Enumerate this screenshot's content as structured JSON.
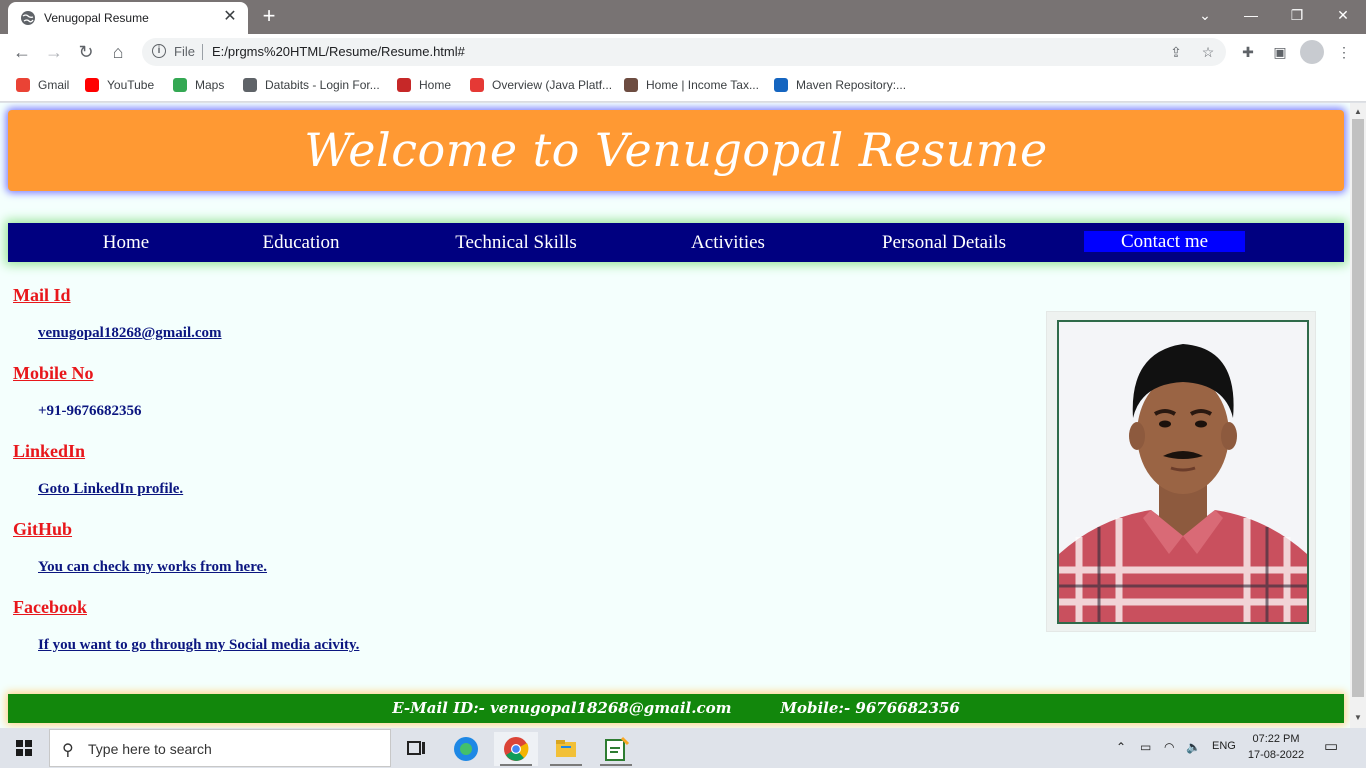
{
  "browser": {
    "tab_title": "Venugopal Resume",
    "tab_close": "✕",
    "new_tab": "+",
    "scheme_label": "File",
    "url": "E:/prgms%20HTML/Resume/Resume.html#",
    "bookmarks": [
      {
        "label": "Gmail",
        "color": "#ea4335"
      },
      {
        "label": "YouTube",
        "color": "#ff0000"
      },
      {
        "label": "Maps",
        "color": "#34a853"
      },
      {
        "label": "Databits - Login For...",
        "color": "#5f6368"
      },
      {
        "label": "Home",
        "color": "#c62828"
      },
      {
        "label": "Overview (Java Platf...",
        "color": "#e53935"
      },
      {
        "label": "Home | Income Tax...",
        "color": "#6d4c41"
      },
      {
        "label": "Maven Repository:...",
        "color": "#1565c0"
      }
    ]
  },
  "page": {
    "banner_title": "Welcome to Venugopal Resume",
    "menu": [
      "Home",
      "Education",
      "Technical Skills",
      "Activities",
      "Personal Details",
      "Contact me"
    ],
    "active_menu": "Contact me",
    "sections": [
      {
        "heading": "Mail Id",
        "value": "venugopal18268@gmail.com",
        "link": true
      },
      {
        "heading": "Mobile No",
        "value": "+91-9676682356",
        "link": false
      },
      {
        "heading": "LinkedIn",
        "value": "Goto LinkedIn profile.",
        "link": true
      },
      {
        "heading": "GitHub",
        "value": "You can check my works from here.",
        "link": true
      },
      {
        "heading": "Facebook",
        "value": "If you want to go through my Social media acivity.",
        "link": true
      }
    ],
    "footer": {
      "email": "E-Mail ID:- venugopal18268@gmail.com",
      "mobile": "Mobile:- 9676682356"
    },
    "colors": {
      "banner": "#ff9933",
      "menubar": "#000080",
      "active_menu": "#0000ff",
      "heading": "#e8171b",
      "value": "#0b1680",
      "footer": "#12870c"
    }
  },
  "taskbar": {
    "search_placeholder": "Type here to search",
    "language": "ENG",
    "time": "07:22 PM",
    "date": "17-08-2022"
  }
}
